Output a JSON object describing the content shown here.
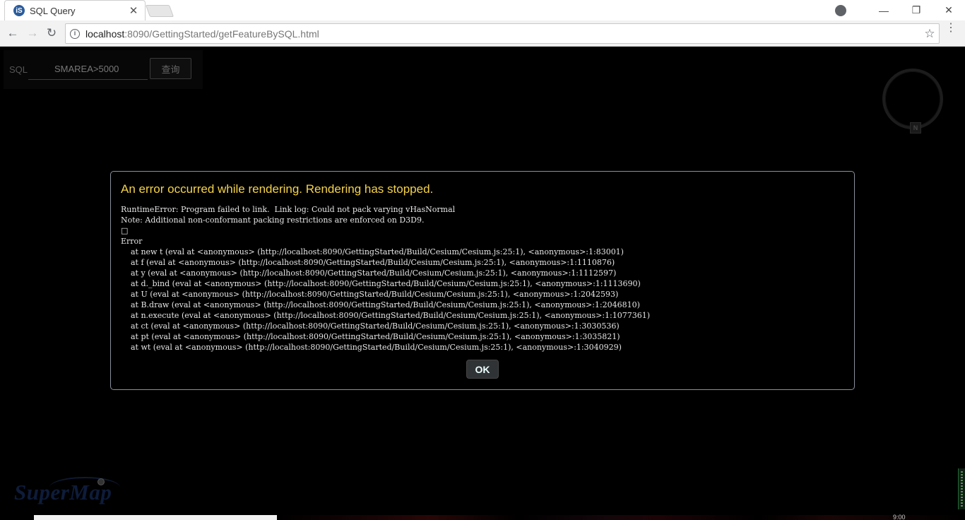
{
  "browser": {
    "tab_title": "SQL Query",
    "tab_favicon": "iS",
    "url_host": "localhost",
    "url_rest": ":8090/GettingStarted/getFeatureBySQL.html"
  },
  "sql_panel": {
    "label": "SQL",
    "input_value": "SMAREA>5000",
    "query_button": "查询"
  },
  "compass": {
    "north_label": "N"
  },
  "logo": {
    "text": "SuperMap"
  },
  "time_fragment": "9:00",
  "error_dialog": {
    "title": "An error occurred while rendering. Rendering has stopped.",
    "message": "RuntimeError: Program failed to link.  Link log: Could not pack varying vHasNormal\nNote: Additional non-conformant packing restrictions are enforced on D3D9.\n□\nError\n    at new t (eval at <anonymous> (http://localhost:8090/GettingStarted/Build/Cesium/Cesium.js:25:1), <anonymous>:1:83001)\n    at f (eval at <anonymous> (http://localhost:8090/GettingStarted/Build/Cesium/Cesium.js:25:1), <anonymous>:1:1110876)\n    at y (eval at <anonymous> (http://localhost:8090/GettingStarted/Build/Cesium/Cesium.js:25:1), <anonymous>:1:1112597)\n    at d._bind (eval at <anonymous> (http://localhost:8090/GettingStarted/Build/Cesium/Cesium.js:25:1), <anonymous>:1:1113690)\n    at U (eval at <anonymous> (http://localhost:8090/GettingStarted/Build/Cesium/Cesium.js:25:1), <anonymous>:1:2042593)\n    at B.draw (eval at <anonymous> (http://localhost:8090/GettingStarted/Build/Cesium/Cesium.js:25:1), <anonymous>:1:2046810)\n    at n.execute (eval at <anonymous> (http://localhost:8090/GettingStarted/Build/Cesium/Cesium.js:25:1), <anonymous>:1:1077361)\n    at ct (eval at <anonymous> (http://localhost:8090/GettingStarted/Build/Cesium/Cesium.js:25:1), <anonymous>:1:3030536)\n    at pt (eval at <anonymous> (http://localhost:8090/GettingStarted/Build/Cesium/Cesium.js:25:1), <anonymous>:1:3035821)\n    at wt (eval at <anonymous> (http://localhost:8090/GettingStarted/Build/Cesium/Cesium.js:25:1), <anonymous>:1:3040929)",
    "ok_button": "OK"
  },
  "colors": {
    "dialog_title": "#f5d347",
    "dialog_border": "#8a8f9c",
    "background": "#000000"
  }
}
